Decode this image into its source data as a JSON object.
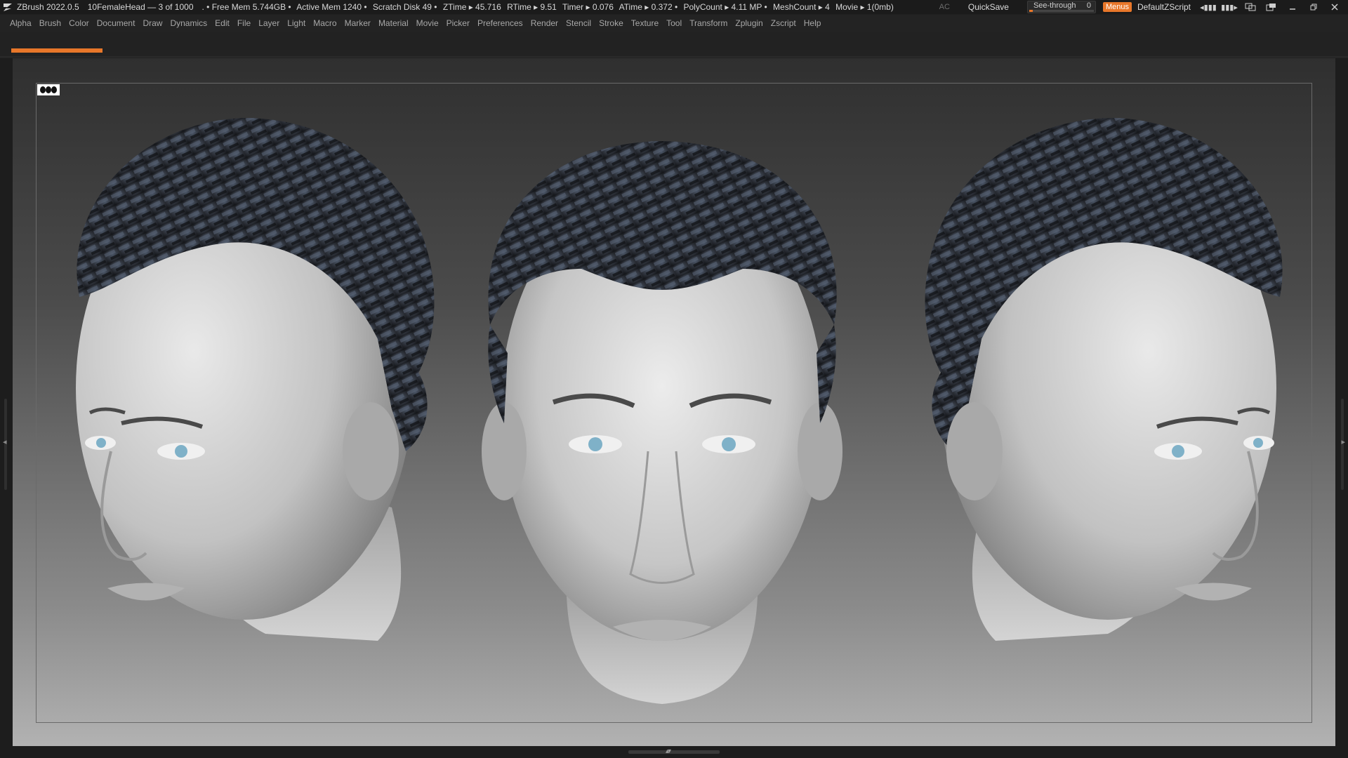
{
  "titlebar": {
    "app_title": "ZBrush 2022.0.5",
    "document": "10FemaleHead — 3 of 1000",
    "status": [
      ". • Free Mem 5.744GB •",
      "Active Mem 1240 •",
      "Scratch Disk 49 •",
      "ZTime ▸ 45.716",
      "RTime ▸ 9.51",
      "Timer ▸ 0.076",
      "ATime ▸ 0.372 •",
      "PolyCount ▸ 4.11 MP •",
      "MeshCount ▸ 4",
      "Movie ▸ 1(0mb)"
    ],
    "ac_label": "AC",
    "quicksave_label": "QuickSave",
    "seethrough_label": "See-through",
    "seethrough_value": "0",
    "seethrough_fraction": 0.0,
    "menus_label": "Menus",
    "script_label": "DefaultZScript",
    "window_icons": [
      "layout-icon-1",
      "layout-icon-2",
      "swap-icon",
      "multi-window-icon",
      "minimize-icon",
      "restore-icon",
      "close-icon"
    ]
  },
  "menubar": {
    "items": [
      "Alpha",
      "Brush",
      "Color",
      "Document",
      "Draw",
      "Dynamics",
      "Edit",
      "File",
      "Layer",
      "Light",
      "Macro",
      "Marker",
      "Material",
      "Movie",
      "Picker",
      "Preferences",
      "Render",
      "Stencil",
      "Stroke",
      "Texture",
      "Tool",
      "Transform",
      "Zplugin",
      "Zscript",
      "Help"
    ]
  },
  "canvas": {
    "perspective_icon": "perspective-heads-icon",
    "subject": "three-sculpted-female-heads-with-short-card-hair"
  },
  "colors": {
    "accent": "#e8772a",
    "titlebar_bg": "#1b1b1b",
    "menu_text": "#a8a8a8",
    "hair": "#2c3038",
    "skin": "#c8c8c8"
  }
}
